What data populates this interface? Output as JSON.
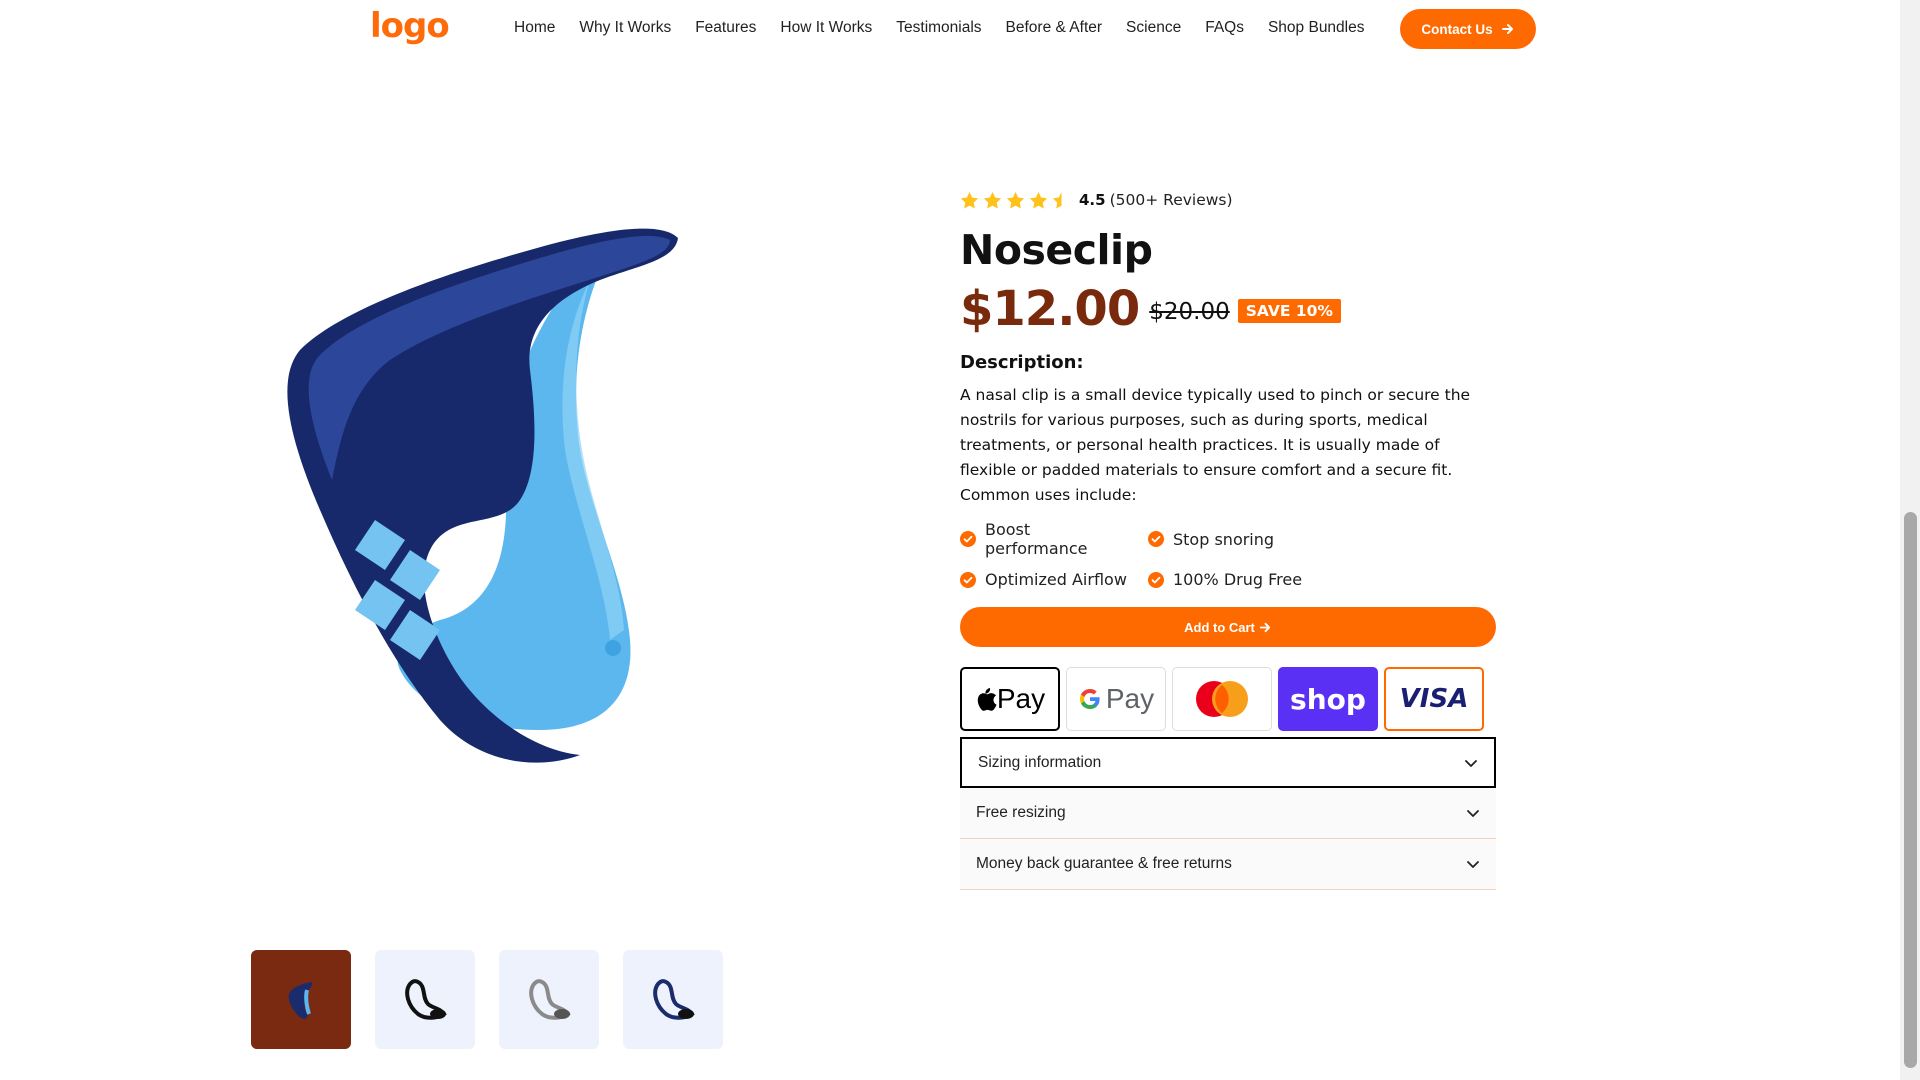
{
  "header": {
    "logo": "logo",
    "nav": [
      "Home",
      "Why It Works",
      "Features",
      "How It Works",
      "Testimonials",
      "Before & After",
      "Science",
      "FAQs",
      "Shop Bundles"
    ],
    "contact_label": "Contact Us"
  },
  "product": {
    "rating_value": "4.5",
    "rating_count": "(500+ Reviews)",
    "rating_stars": 4.5,
    "title": "Noseclip",
    "price": "$12.00",
    "old_price": "$20.00",
    "save_badge": "SAVE 10%",
    "description_title": "Description:",
    "description": "A nasal clip is a small device typically used to pinch or secure the nostrils for various purposes, such as during sports, medical treatments, or personal health practices. It is usually made of flexible or padded materials to ensure comfort and a secure fit. Common uses include:",
    "features": [
      "Boost performance",
      "Stop snoring",
      "Optimized Airflow",
      "100% Drug Free"
    ],
    "add_to_cart": "Add to Cart",
    "payments": {
      "apple": "Pay",
      "google": "Pay",
      "shop": "shop",
      "visa": "VISA"
    },
    "accordion": [
      "Sizing information",
      "Free resizing",
      "Money back guarantee & free returns"
    ]
  },
  "colors": {
    "accent": "#ff6a00",
    "price": "#7a2a0c",
    "shop_pay": "#5a31f4",
    "star": "#ffc21a",
    "thumb_active": "#7a2a10",
    "thumb_bg": "#eef2fc"
  },
  "icons": [
    "arrow-right-icon",
    "star-icon",
    "check-circle-icon",
    "chevron-down-icon",
    "apple-icon",
    "google-g-icon",
    "mastercard-icon"
  ]
}
